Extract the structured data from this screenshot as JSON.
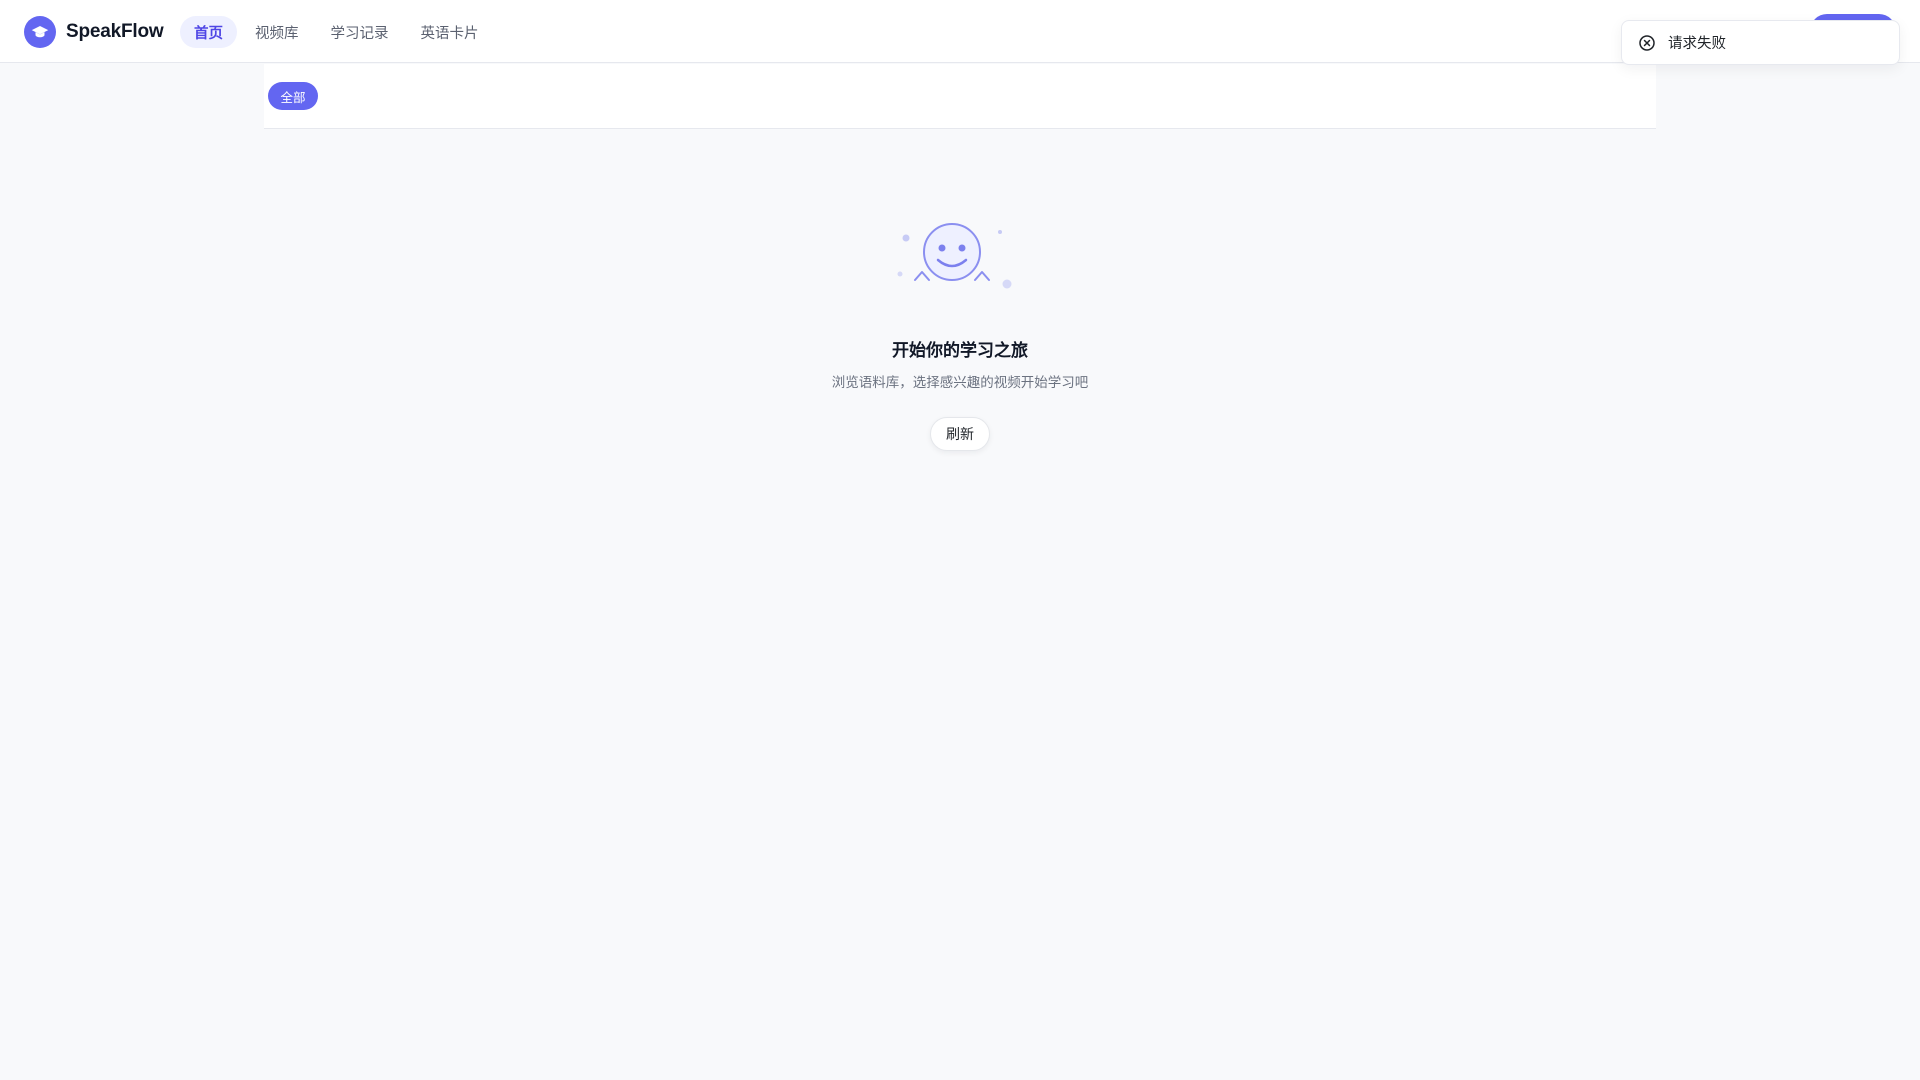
{
  "app": {
    "name": "SpeakFlow",
    "logo_icon": "graduation-cap-icon"
  },
  "nav": {
    "items": [
      {
        "label": "首页",
        "active": true
      },
      {
        "label": "视频库",
        "active": false
      },
      {
        "label": "学习记录",
        "active": false
      },
      {
        "label": "英语卡片",
        "active": false
      }
    ]
  },
  "toast": {
    "icon": "close-circle-icon",
    "text": "请求失败"
  },
  "filters": {
    "chips": [
      {
        "label": "全部",
        "active": true
      }
    ]
  },
  "empty_state": {
    "illustration": "smiley-face-icon",
    "title": "开始你的学习之旅",
    "description": "浏览语料库，选择感兴趣的视频开始学习吧",
    "refresh_label": "刷新"
  },
  "colors": {
    "accent": "#6366f1",
    "accent_light": "#eef0ff",
    "background": "#f8f9fb"
  }
}
